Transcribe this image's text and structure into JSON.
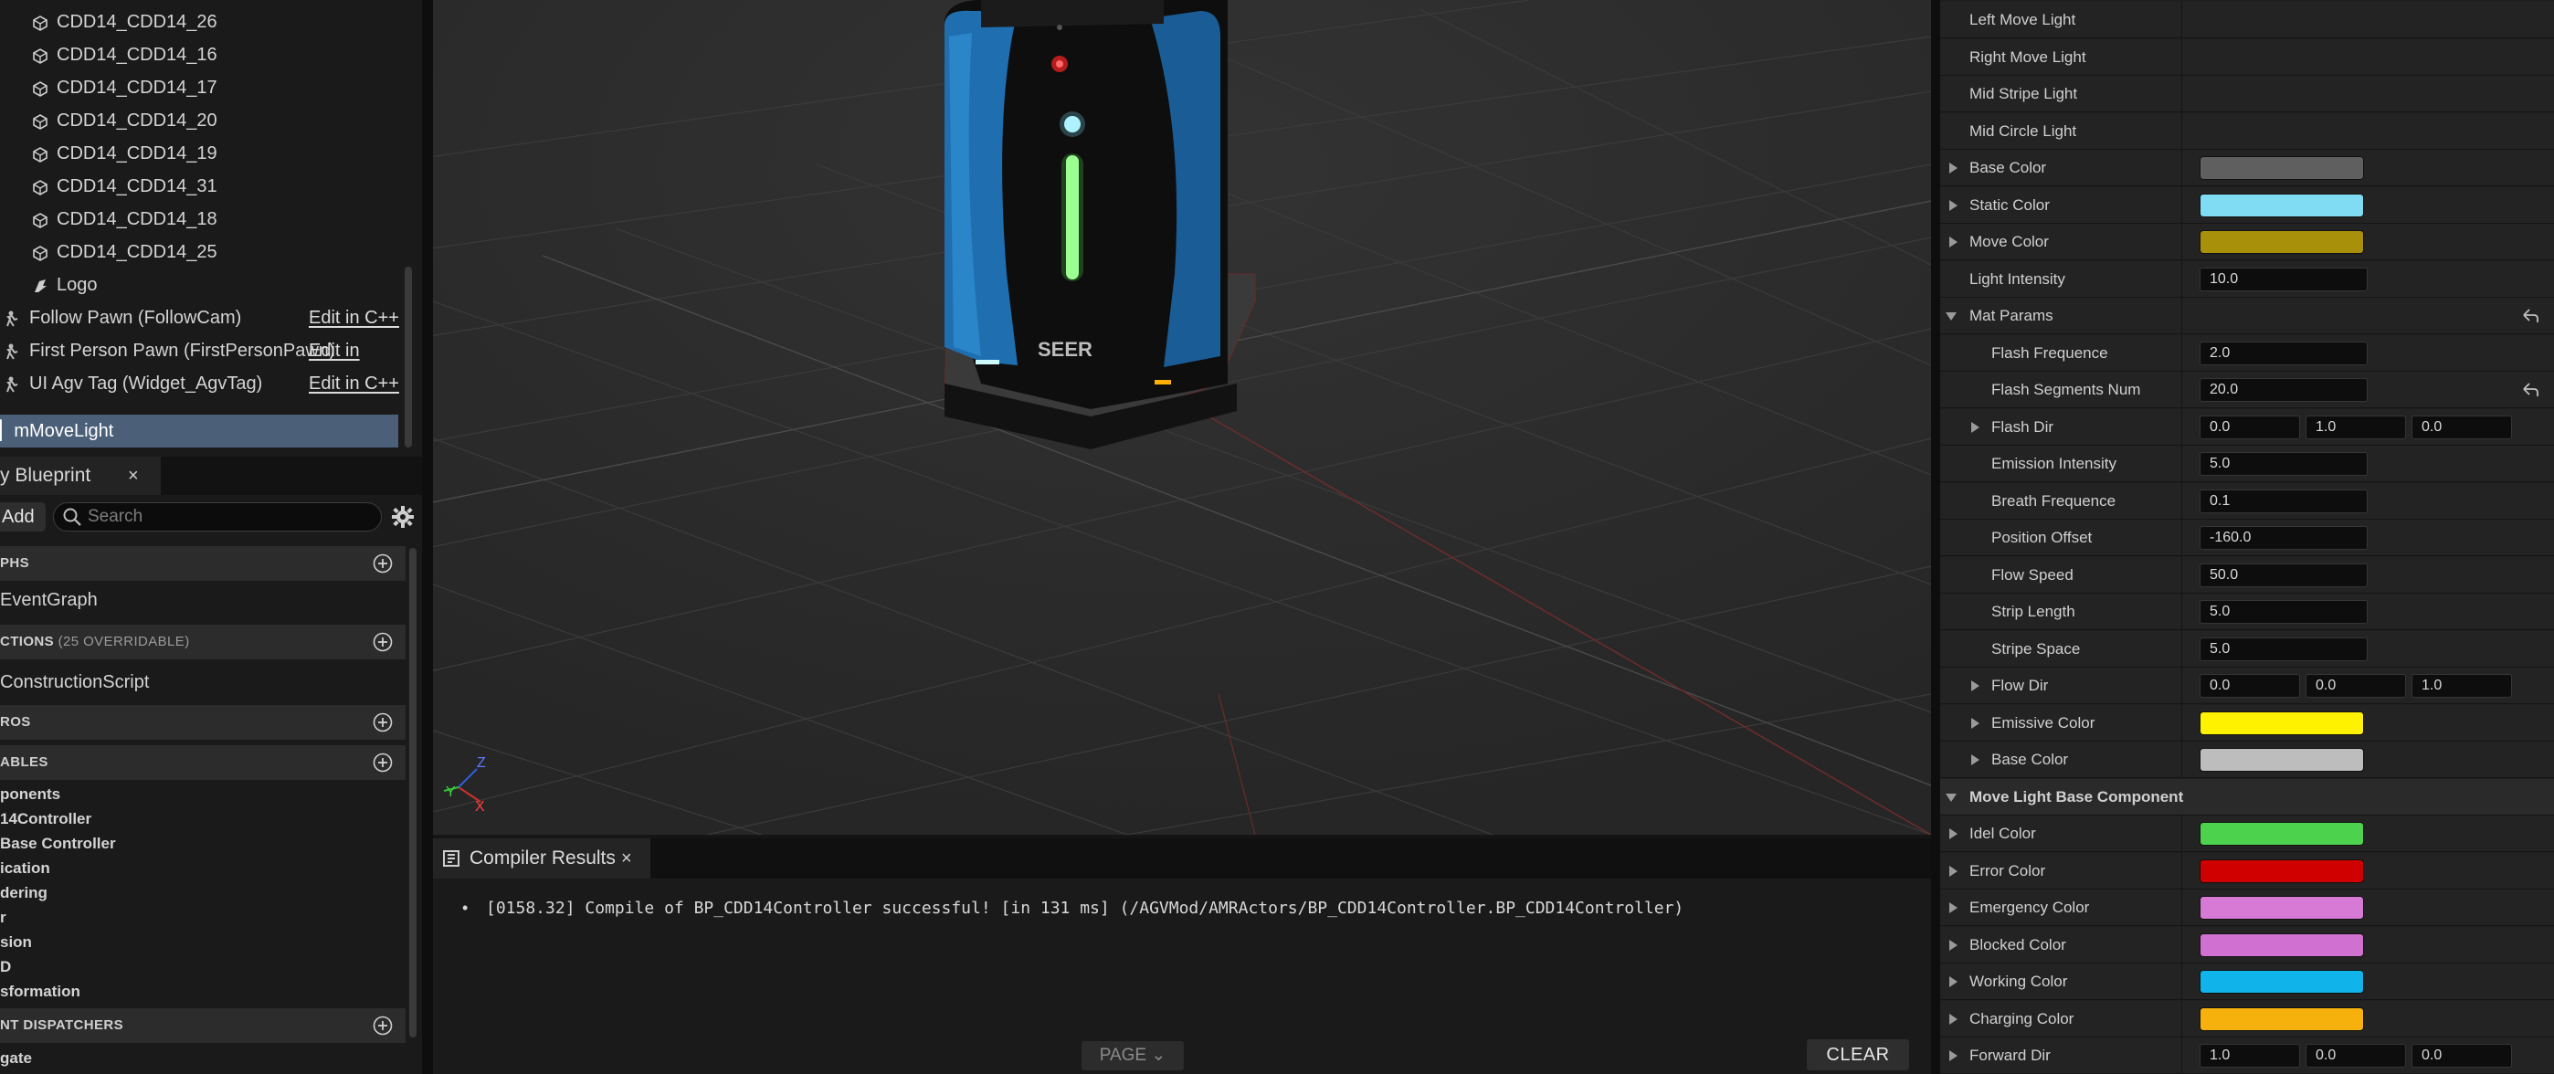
{
  "outliner": {
    "mesh_items": [
      "CDD14_CDD14_26",
      "CDD14_CDD14_16",
      "CDD14_CDD14_17",
      "CDD14_CDD14_20",
      "CDD14_CDD14_19",
      "CDD14_CDD14_31",
      "CDD14_CDD14_18",
      "CDD14_CDD14_25"
    ],
    "logo_item": "Logo",
    "pawn_items": [
      {
        "label": "Follow Pawn (FollowCam)",
        "edit": "Edit in C++"
      },
      {
        "label": "First Person Pawn (FirstPersonPawn)",
        "edit": "Edit in"
      },
      {
        "label": "UI Agv Tag (Widget_AgvTag)",
        "edit": "Edit in C++"
      }
    ],
    "selected": "mMoveLight"
  },
  "my_blueprint": {
    "tab_label": "y Blueprint",
    "tab_close": "×",
    "add_label": "Add",
    "search_placeholder": "Search",
    "graphs_header": "PHS",
    "graphs": [
      "EventGraph"
    ],
    "functions_header": "CTIONS",
    "functions_sub": "(25 OVERRIDABLE)",
    "functions": [
      "ConstructionScript"
    ],
    "macros_header": "ROS",
    "variables_header": "ABLES",
    "variables": [
      "ponents",
      "14Controller",
      "Base Controller",
      "ication",
      "dering",
      "r",
      "sion",
      "D",
      "sformation"
    ],
    "dispatchers_header": "NT DISPATCHERS",
    "dispatchers": [
      "gate"
    ]
  },
  "viewport": {
    "robot_brand": "SEER",
    "axis": {
      "x": "X",
      "y": "Y",
      "z": "Z"
    }
  },
  "compiler": {
    "tab_label": "Compiler Results",
    "tab_close": "×",
    "message": "[0158.32] Compile of BP_CDD14Controller successful! [in 131 ms] (/AGVMod/AMRActors/BP_CDD14Controller.BP_CDD14Controller)",
    "page_label": "PAGE",
    "clear_label": "CLEAR"
  },
  "details": {
    "rows": [
      {
        "name": "Left Move Light",
        "type": "plain",
        "indent": 0
      },
      {
        "name": "Right Move Light",
        "type": "plain",
        "indent": 0
      },
      {
        "name": "Mid Stripe Light",
        "type": "plain",
        "indent": 0
      },
      {
        "name": "Mid Circle Light",
        "type": "plain",
        "indent": 0
      },
      {
        "name": "Base Color",
        "type": "color",
        "color": "#5f5f5f",
        "expand": "right",
        "indent": 0
      },
      {
        "name": "Static Color",
        "type": "color",
        "color": "#7fdcf3",
        "expand": "right",
        "indent": 0
      },
      {
        "name": "Move Color",
        "type": "color",
        "color": "#a8900a",
        "expand": "right",
        "indent": 0
      },
      {
        "name": "Light Intensity",
        "type": "num",
        "values": [
          "10.0"
        ],
        "indent": 0
      },
      {
        "name": "Mat Params",
        "type": "plain",
        "expand": "down",
        "indent": 0,
        "reset": true
      },
      {
        "name": "Flash Frequence",
        "type": "num",
        "values": [
          "2.0"
        ],
        "indent": 1
      },
      {
        "name": "Flash Segments Num",
        "type": "num",
        "values": [
          "20.0"
        ],
        "indent": 1,
        "reset": true
      },
      {
        "name": "Flash Dir",
        "type": "vec",
        "values": [
          "0.0",
          "1.0",
          "0.0"
        ],
        "expand": "right",
        "indent": 1
      },
      {
        "name": "Emission Intensity",
        "type": "num",
        "values": [
          "5.0"
        ],
        "indent": 1
      },
      {
        "name": "Breath Frequence",
        "type": "num",
        "values": [
          "0.1"
        ],
        "indent": 1
      },
      {
        "name": "Position Offset",
        "type": "num",
        "values": [
          "-160.0"
        ],
        "indent": 1
      },
      {
        "name": "Flow Speed",
        "type": "num",
        "values": [
          "50.0"
        ],
        "indent": 1
      },
      {
        "name": "Strip Length",
        "type": "num",
        "values": [
          "5.0"
        ],
        "indent": 1
      },
      {
        "name": "Stripe Space",
        "type": "num",
        "values": [
          "5.0"
        ],
        "indent": 1
      },
      {
        "name": "Flow Dir",
        "type": "vec",
        "values": [
          "0.0",
          "0.0",
          "1.0"
        ],
        "expand": "right",
        "indent": 1
      },
      {
        "name": "Emissive Color",
        "type": "color",
        "color": "#fff200",
        "expand": "right",
        "indent": 1
      },
      {
        "name": "Base Color",
        "type": "color",
        "color": "#bdbdbd",
        "expand": "right",
        "indent": 1
      },
      {
        "name": "Move Light Base Component",
        "type": "header",
        "expand": "down",
        "indent": 0
      },
      {
        "name": "Idel Color",
        "type": "color",
        "color": "#4cd24c",
        "expand": "right",
        "indent": 0
      },
      {
        "name": "Error Color",
        "type": "color",
        "color": "#d00000",
        "expand": "right",
        "indent": 0
      },
      {
        "name": "Emergency Color",
        "type": "color",
        "color": "#d67ad6",
        "expand": "right",
        "indent": 0
      },
      {
        "name": "Blocked Color",
        "type": "color",
        "color": "#d070d0",
        "expand": "right",
        "indent": 0
      },
      {
        "name": "Working Color",
        "type": "color",
        "color": "#10b4ea",
        "expand": "right",
        "indent": 0
      },
      {
        "name": "Charging Color",
        "type": "color",
        "color": "#f7b10d",
        "expand": "right",
        "indent": 0
      },
      {
        "name": "Forward Dir",
        "type": "vec",
        "values": [
          "1.0",
          "0.0",
          "0.0"
        ],
        "expand": "right",
        "indent": 0
      }
    ]
  },
  "colors": {
    "selection": "#4b6078",
    "panel": "#1a1a1a",
    "viewport": "#2d2d2d"
  }
}
